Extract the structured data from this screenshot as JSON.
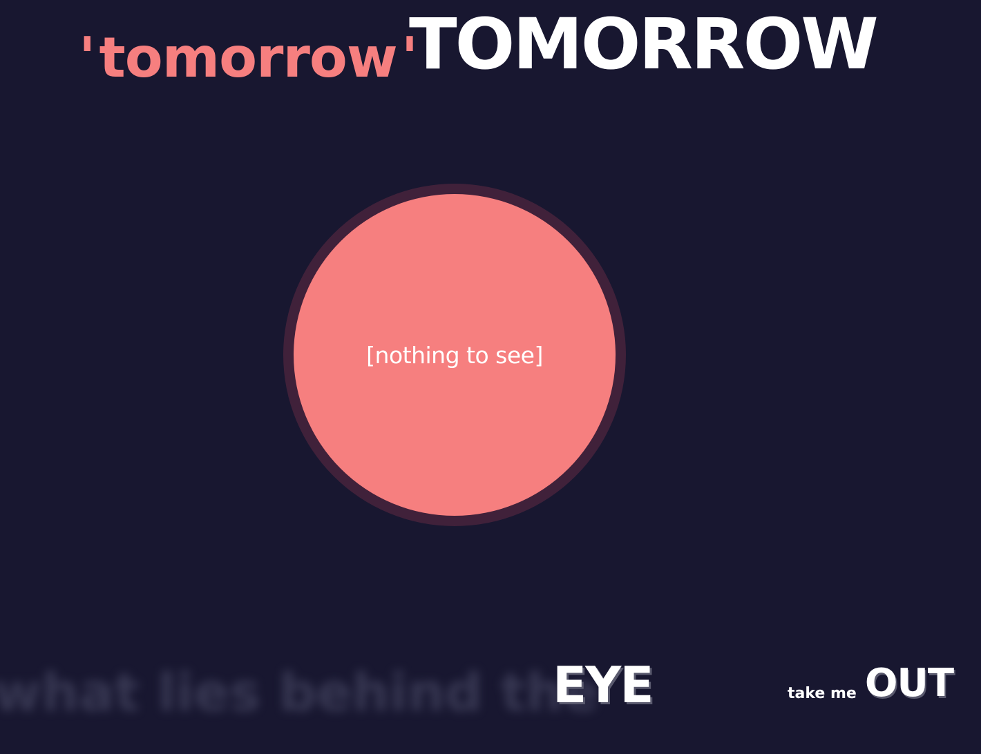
{
  "header": {
    "quote_open": "'",
    "quoted_word": "tomorrow",
    "quote_close": "'",
    "title": "TOMORROW"
  },
  "orb": {
    "caption": "[nothing to see]"
  },
  "footer": {
    "blurred_text": "what lies behind the",
    "emphasis_word": "EYE",
    "exit_small": "take me",
    "exit_big": "OUT"
  },
  "colors": {
    "background": "#181730",
    "accent": "#f67f7f",
    "orb_ring": "#40213a",
    "text": "#ffffff"
  }
}
